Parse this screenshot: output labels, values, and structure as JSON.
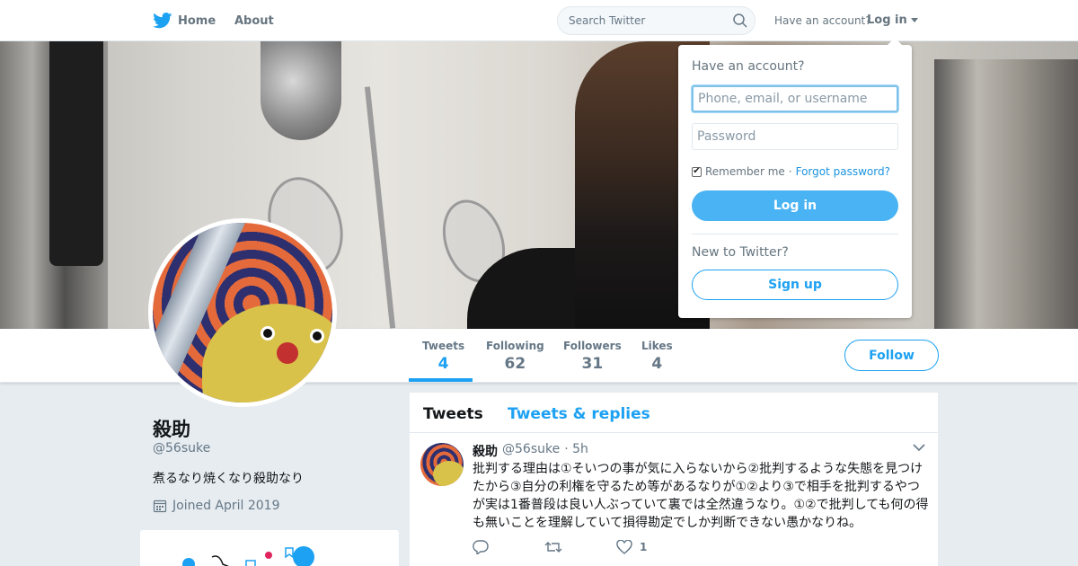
{
  "topnav": {
    "logo_icon": "twitter-bird-icon",
    "home_label": "Home",
    "about_label": "About",
    "search_placeholder": "Search Twitter",
    "have_account": "Have an account?",
    "login_label": "Log in"
  },
  "profile": {
    "name": "殺助",
    "handle": "@56suke",
    "bio": "煮るなり焼くなり殺助なり",
    "joined": "Joined April 2019",
    "follow_label": "Follow"
  },
  "stats": [
    {
      "label": "Tweets",
      "value": "4",
      "active": true
    },
    {
      "label": "Following",
      "value": "62",
      "active": false
    },
    {
      "label": "Followers",
      "value": "31",
      "active": false
    },
    {
      "label": "Likes",
      "value": "4",
      "active": false
    }
  ],
  "timeline": {
    "tabs": [
      {
        "label": "Tweets",
        "active": true
      },
      {
        "label": "Tweets & replies",
        "active": false
      }
    ],
    "tweet": {
      "name": "殺助",
      "handle": "@56suke",
      "time": "· 5h",
      "text": "批判する理由は①そいつの事が気に入らないから②批判するような失態を見つけたから③自分の利権を守るため等があるなりが①②より③で相手を批判するやつが実は1番普段は良い人ぶっていて裏では全然違うなり。①②で批判しても何の得も無いことを理解していて損得勘定でしか判断できない愚かなりね。",
      "like_count": "1"
    }
  },
  "login_dropdown": {
    "title": "Have an account?",
    "username_placeholder": "Phone, email, or username",
    "password_placeholder": "Password",
    "remember_label": "Remember me",
    "separator": "·",
    "forgot_label": "Forgot password?",
    "login_button": "Log in",
    "new_label": "New to Twitter?",
    "signup_button": "Sign up"
  },
  "colors": {
    "accent": "#1da1f2",
    "login_button": "#4ab3f4",
    "muted_text": "#657786",
    "page_bg": "#e6ecf0"
  }
}
